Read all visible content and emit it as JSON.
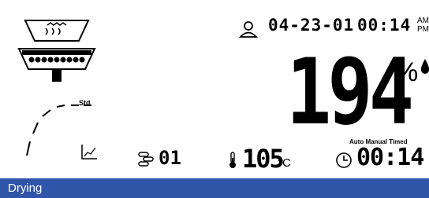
{
  "display": {
    "date": "04-23-01",
    "time": "00:14",
    "am": "AM",
    "pm": "PM",
    "main_value": "194",
    "main_unit": "%",
    "chart_label": "Std",
    "channel": "01",
    "temperature": "105",
    "temperature_unit": "°C",
    "timer": "00:14",
    "timer_modes": "Auto Manual Timed"
  },
  "status": {
    "text": "Drying",
    "bar_color": "#2f55a8"
  },
  "icons": {
    "heater": "heater-icon",
    "user": "user-icon",
    "moisture": "water-drop-icon",
    "trend": "trend-chart-icon",
    "sample": "sample-stack-icon",
    "thermometer": "thermometer-icon",
    "clock": "clock-icon"
  }
}
